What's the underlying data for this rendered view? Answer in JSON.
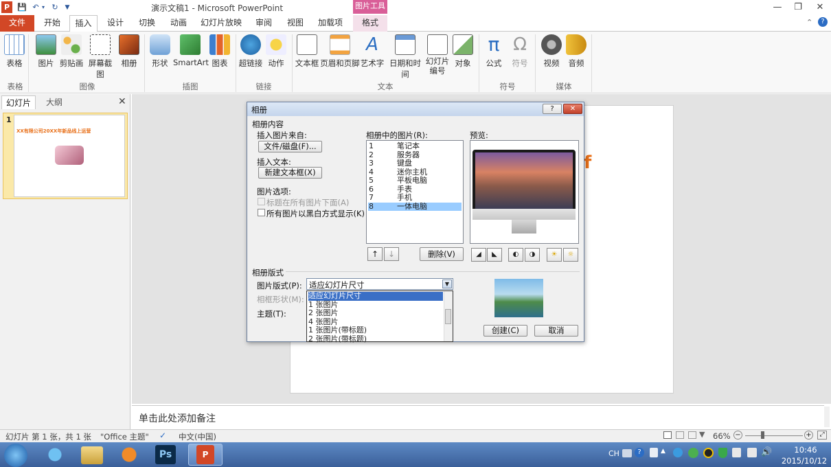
{
  "title_bar": {
    "app_icon": "P",
    "title": "演示文稿1 - Microsoft PowerPoint",
    "context_tool": "图片工具"
  },
  "tabs": [
    "文件",
    "开始",
    "插入",
    "设计",
    "切换",
    "动画",
    "幻灯片放映",
    "审阅",
    "视图",
    "加载项",
    "格式"
  ],
  "ribbon": {
    "buttons": [
      "表格",
      "图片",
      "剪贴画",
      "屏幕截图",
      "相册",
      "形状",
      "SmartArt",
      "图表",
      "超链接",
      "动作",
      "文本框",
      "页眉和页脚",
      "艺术字",
      "日期和时间",
      "幻灯片\n编号",
      "对象",
      "公式",
      "符号",
      "视频",
      "音频"
    ],
    "groups": [
      "表格",
      "图像",
      "插图",
      "链接",
      "文本",
      "符号",
      "媒体"
    ]
  },
  "left_pane": {
    "tab_slides": "幻灯片",
    "tab_outline": "大纲",
    "slide_number": "1",
    "thumb_title": "XX有限公司20XX年新品线上运营"
  },
  "slide": {
    "partial_text": "f"
  },
  "notes_placeholder": "单击此处添加备注",
  "status_bar": {
    "slide_info": "幻灯片 第 1 张，共 1 张",
    "theme": "\"Office 主题\"",
    "language": "中文(中国)",
    "zoom": "66%"
  },
  "taskbar": {
    "ime": "CH",
    "time": "10:46",
    "date": "2015/10/12"
  },
  "dialog": {
    "title": "相册",
    "section_content": "相册内容",
    "insert_from_label": "插入图片来自:",
    "file_disk_button": "文件/磁盘(F)...",
    "insert_text_label": "插入文本:",
    "new_textbox_button": "新建文本框(X)",
    "picture_options_label": "图片选项:",
    "caption_option": "标题在所有图片下面(A)",
    "bw_option": "所有图片以黑白方式显示(K)",
    "pictures_in_album_label": "相册中的图片(R):",
    "pictures": [
      {
        "num": "1",
        "name": "笔记本"
      },
      {
        "num": "2",
        "name": "服务器"
      },
      {
        "num": "3",
        "name": "键盘"
      },
      {
        "num": "4",
        "name": "迷你主机"
      },
      {
        "num": "5",
        "name": "平板电脑"
      },
      {
        "num": "6",
        "name": "手表"
      },
      {
        "num": "7",
        "name": "手机"
      },
      {
        "num": "8",
        "name": "一体电脑"
      }
    ],
    "selected_picture": "8",
    "preview_label": "预览:",
    "move_up": "↑",
    "move_down": "↓",
    "delete_button": "删除(V)",
    "section_layout": "相册版式",
    "layout_label": "图片版式(P):",
    "layout_value": "适应幻灯片尺寸",
    "layout_options": [
      "适应幻灯片尺寸",
      "1 张图片",
      "2 张图片",
      "4 张图片",
      "1 张图片(带标题)",
      "2 张图片(带标题)"
    ],
    "frame_label": "相框形状(M):",
    "theme_label": "主题(T):",
    "create_button": "创建(C)",
    "cancel_button": "取消",
    "help_button": "?",
    "close_button": "✕"
  },
  "colors": {
    "file_tab": "#d24726",
    "picture_tools": "#d95e98",
    "selection": "#99ccff"
  }
}
